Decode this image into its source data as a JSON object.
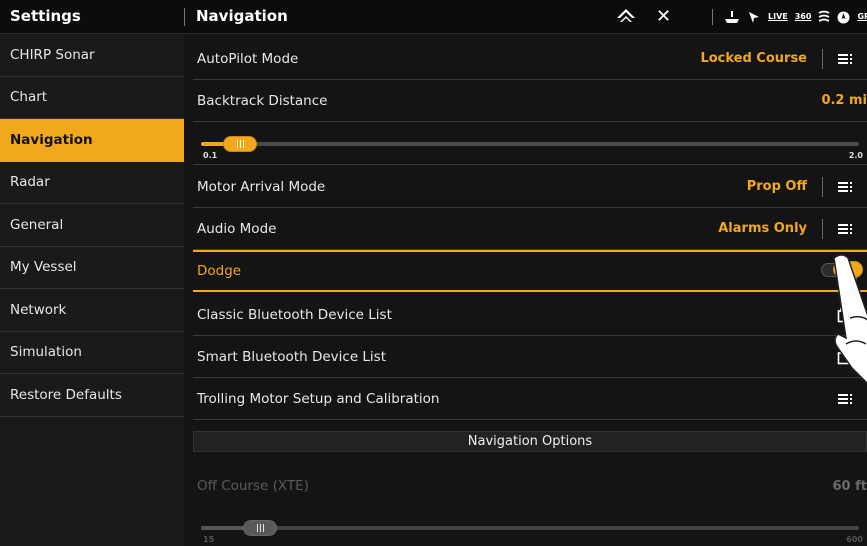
{
  "topbar": {
    "left_title": "Settings",
    "right_title": "Navigation",
    "home_icon": "home-icon",
    "close_icon": "x-icon",
    "status_icons": [
      "boat-icon",
      "gps-arrow-icon",
      "LIVE",
      "360",
      "sonar-icon",
      "compass-icon",
      "GP"
    ]
  },
  "sidebar": {
    "items": [
      {
        "label": "CHIRP Sonar",
        "active": false
      },
      {
        "label": "Chart",
        "active": false
      },
      {
        "label": "Navigation",
        "active": true
      },
      {
        "label": "Radar",
        "active": false
      },
      {
        "label": "General",
        "active": false
      },
      {
        "label": "My Vessel",
        "active": false
      },
      {
        "label": "Network",
        "active": false
      },
      {
        "label": "Simulation",
        "active": false
      },
      {
        "label": "Restore Defaults",
        "active": false
      }
    ]
  },
  "main": {
    "autopilot": {
      "label": "AutoPilot Mode",
      "value": "Locked Course"
    },
    "backtrack": {
      "label": "Backtrack Distance",
      "value": "0.2 mi"
    },
    "backtrack_slider": {
      "min": "0.1",
      "max": "2.0",
      "value": 0.2
    },
    "motor_arrival": {
      "label": "Motor Arrival Mode",
      "value": "Prop Off"
    },
    "audio": {
      "label": "Audio Mode",
      "value": "Alarms Only"
    },
    "dodge": {
      "label": "Dodge",
      "toggle_state": "ON"
    },
    "classic_bt": {
      "label": "Classic Bluetooth Device List"
    },
    "smart_bt": {
      "label": "Smart Bluetooth Device List"
    },
    "trolling": {
      "label": "Trolling Motor Setup and Calibration"
    },
    "section_title": "Navigation Options",
    "off_course": {
      "label": "Off Course (XTE)",
      "value": "60 ft"
    },
    "off_course_slider": {
      "min": "15",
      "max": "600",
      "value": 60
    }
  },
  "colors": {
    "accent": "#f2a81d",
    "background": "#141414",
    "sidebar": "#1a1a1a",
    "disabled_text": "#5a5a5a"
  }
}
